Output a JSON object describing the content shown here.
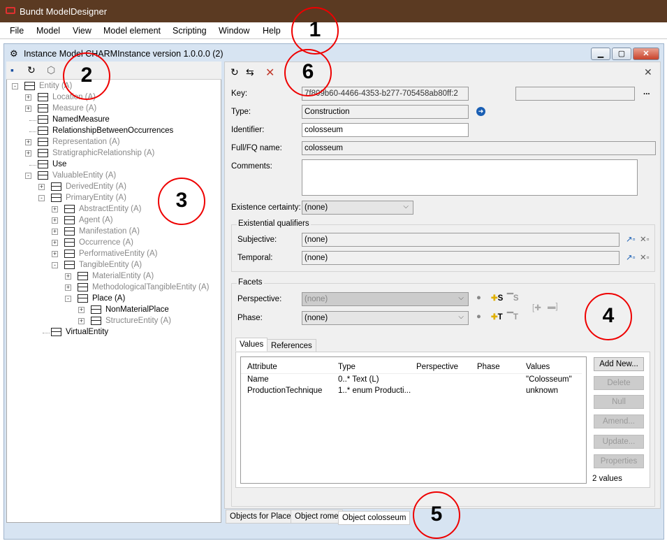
{
  "app": {
    "title": "Bundt ModelDesigner",
    "accent": "#5b3a22"
  },
  "menu": [
    "File",
    "Model",
    "View",
    "Model element",
    "Scripting",
    "Window",
    "Help"
  ],
  "window": {
    "title": "Instance Model CHARMInstance version 1.0.0.0 (2)"
  },
  "left_toolbar": {
    "icons": [
      "save-icon",
      "refresh-icon",
      "cube-icon"
    ]
  },
  "tree": [
    {
      "label": "Entity (A)",
      "level": 0,
      "toggle": "-",
      "abstract": true
    },
    {
      "label": "Location (A)",
      "level": 1,
      "toggle": "+",
      "abstract": true
    },
    {
      "label": "Measure (A)",
      "level": 1,
      "toggle": "+",
      "abstract": true
    },
    {
      "label": "NamedMeasure",
      "level": 1,
      "toggle": "",
      "abstract": false
    },
    {
      "label": "RelationshipBetweenOccurrences",
      "level": 1,
      "toggle": "",
      "abstract": false
    },
    {
      "label": "Representation (A)",
      "level": 1,
      "toggle": "+",
      "abstract": true
    },
    {
      "label": "StratigraphicRelationship (A)",
      "level": 1,
      "toggle": "+",
      "abstract": true
    },
    {
      "label": "Use",
      "level": 1,
      "toggle": "",
      "abstract": false
    },
    {
      "label": "ValuableEntity (A)",
      "level": 1,
      "toggle": "-",
      "abstract": true
    },
    {
      "label": "DerivedEntity (A)",
      "level": 2,
      "toggle": "+",
      "abstract": true
    },
    {
      "label": "PrimaryEntity (A)",
      "level": 2,
      "toggle": "-",
      "abstract": true
    },
    {
      "label": "AbstractEntity (A)",
      "level": 3,
      "toggle": "+",
      "abstract": true
    },
    {
      "label": "Agent (A)",
      "level": 3,
      "toggle": "+",
      "abstract": true
    },
    {
      "label": "Manifestation (A)",
      "level": 3,
      "toggle": "+",
      "abstract": true
    },
    {
      "label": "Occurrence (A)",
      "level": 3,
      "toggle": "+",
      "abstract": true
    },
    {
      "label": "PerformativeEntity (A)",
      "level": 3,
      "toggle": "+",
      "abstract": true
    },
    {
      "label": "TangibleEntity (A)",
      "level": 3,
      "toggle": "-",
      "abstract": true
    },
    {
      "label": "MaterialEntity (A)",
      "level": 4,
      "toggle": "+",
      "abstract": true
    },
    {
      "label": "MethodologicalTangibleEntity (A)",
      "level": 4,
      "toggle": "+",
      "abstract": true
    },
    {
      "label": "Place (A)",
      "level": 4,
      "toggle": "-",
      "abstract": false
    },
    {
      "label": "NonMaterialPlace",
      "level": 5,
      "toggle": "+",
      "abstract": false
    },
    {
      "label": "StructureEntity (A)",
      "level": 5,
      "toggle": "+",
      "abstract": true
    },
    {
      "label": "VirtualEntity",
      "level": 2,
      "toggle": "",
      "abstract": false
    }
  ],
  "form": {
    "key_label": "Key:",
    "key_value": "7f809b60-4466-4353-b277-705458ab80ff:2",
    "key_extra": "",
    "more": "...",
    "type_label": "Type:",
    "type_value": "Construction",
    "identifier_label": "Identifier:",
    "identifier_value": "colosseum",
    "fullname_label": "Full/FQ name:",
    "fullname_value": "colosseum",
    "comments_label": "Comments:",
    "comments_value": "",
    "certainty_label": "Existence certainty:",
    "certainty_value": "(none)",
    "existential_title": "Existential qualifiers",
    "subjective_label": "Subjective:",
    "subjective_value": "(none)",
    "temporal_label": "Temporal:",
    "temporal_value": "(none)",
    "facets_title": "Facets",
    "perspective_label": "Perspective:",
    "perspective_value": "(none)",
    "phase_label": "Phase:",
    "phase_value": "(none)"
  },
  "inner_tabs": [
    "Values",
    "References"
  ],
  "table": {
    "headers": [
      "Attribute",
      "Type",
      "Perspective",
      "Phase",
      "Values"
    ],
    "rows": [
      [
        "Name",
        "0..* Text (L)",
        "",
        "",
        "\"Colosseum\""
      ],
      [
        "ProductionTechnique",
        "1..* enum Producti...",
        "",
        "",
        "unknown"
      ]
    ],
    "count": "2 values"
  },
  "side_buttons": [
    {
      "label": "Add New...",
      "enabled": true
    },
    {
      "label": "Delete",
      "enabled": false
    },
    {
      "label": "Null",
      "enabled": false
    },
    {
      "label": "Amend...",
      "enabled": false
    },
    {
      "label": "Update...",
      "enabled": false
    },
    {
      "label": "Properties",
      "enabled": false
    }
  ],
  "bottom_tabs": [
    "Objects for Place",
    "Object rome",
    "Object colosseum"
  ],
  "annotations": [
    "1",
    "2",
    "3",
    "4",
    "5",
    "6"
  ]
}
